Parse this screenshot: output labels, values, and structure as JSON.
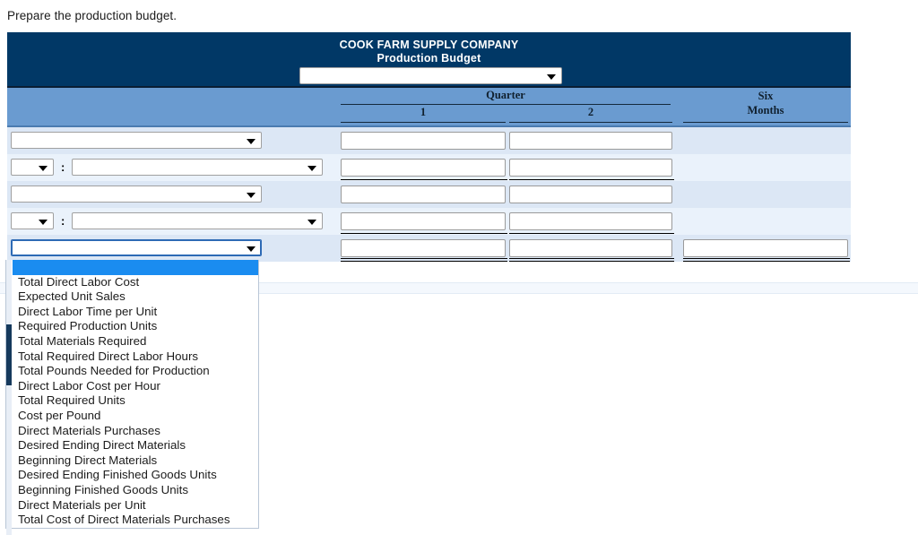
{
  "instruction": "Prepare the production budget.",
  "worksheet": {
    "company": "COOK FARM SUPPLY COMPANY",
    "statement": "Production Budget",
    "period_select_value": "",
    "columns": {
      "quarter_group": "Quarter",
      "q1": "1",
      "q2": "2",
      "six_months_line1": "Six",
      "six_months_line2": "Months"
    },
    "rows": [
      {
        "type": "single-select",
        "label_value": "",
        "q1_value": "",
        "q2_value": "",
        "six_value": null,
        "rule": "none"
      },
      {
        "type": "prefix-select",
        "prefix_value": "",
        "separator": ":",
        "label_value": "",
        "q1_value": "",
        "q2_value": "",
        "six_value": null,
        "rule": "single"
      },
      {
        "type": "single-select",
        "label_value": "",
        "q1_value": "",
        "q2_value": "",
        "six_value": null,
        "rule": "none"
      },
      {
        "type": "prefix-select",
        "prefix_value": "",
        "separator": ":",
        "label_value": "",
        "q1_value": "",
        "q2_value": "",
        "six_value": null,
        "rule": "single"
      },
      {
        "type": "single-select-open",
        "label_value": "",
        "q1_value": "",
        "q2_value": "",
        "six_value": "",
        "rule": "double"
      }
    ]
  },
  "open_dropdown": {
    "selected_index": 0,
    "options": [
      "",
      "Total Direct Labor Cost",
      "Expected Unit Sales",
      "Direct Labor Time per Unit",
      "Required Production Units",
      "Total Materials Required",
      "Total Required Direct Labor Hours",
      "Total Pounds Needed for Production",
      "Direct Labor Cost per Hour",
      "Total Required Units",
      "Cost per Pound",
      "Direct Materials Purchases",
      "Desired Ending Direct Materials",
      "Beginning Direct Materials",
      "Desired Ending Finished Goods Units",
      "Beginning Finished Goods Units",
      "Direct Materials per Unit",
      "Total Cost of Direct Materials Purchases"
    ]
  },
  "colors": {
    "header_navy": "#013866",
    "column_band_blue": "#6a9bd0",
    "row_a": "#dce7f5",
    "row_b": "#eaf2fb",
    "highlight_blue": "#1a8cf0"
  }
}
